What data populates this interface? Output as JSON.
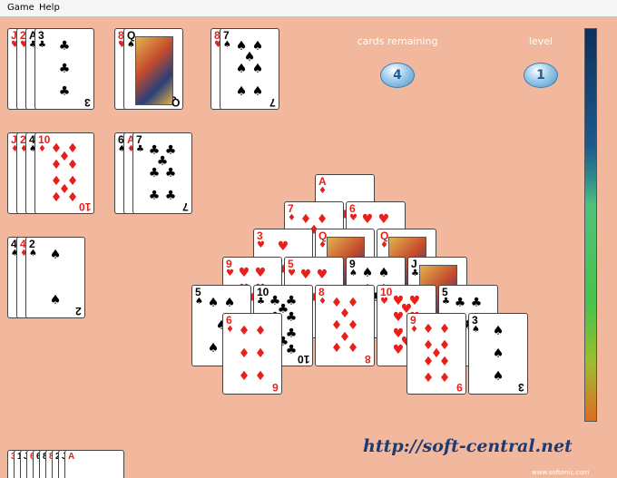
{
  "menu": [
    "Game",
    "Help"
  ],
  "stats": {
    "cards_label": "cards remaining",
    "cards_value": "4",
    "level_label": "level",
    "level_value": "1"
  },
  "footer": {
    "url": "http://soft-central.net",
    "copyright": "www.softonic.com"
  },
  "colors": {
    "background": "#f2b89d",
    "red": "#e8201a",
    "black": "#000000",
    "text_on_felt": "#ffffff",
    "url": "#1c3a73"
  },
  "stacks": [
    {
      "name": "stack-1",
      "under": [
        {
          "r": "J",
          "s": "♥"
        },
        {
          "r": "2",
          "s": "♥"
        },
        {
          "r": "A",
          "s": "♣"
        }
      ],
      "top": {
        "r": "3",
        "s": "♣"
      }
    },
    {
      "name": "stack-2",
      "under": [
        {
          "r": "8",
          "s": "♥"
        }
      ],
      "top": {
        "r": "Q",
        "s": "♠"
      }
    },
    {
      "name": "stack-3",
      "under": [
        {
          "r": "8",
          "s": "♥"
        }
      ],
      "top": {
        "r": "7",
        "s": "♠"
      }
    },
    {
      "name": "stack-4",
      "under": [
        {
          "r": "J",
          "s": "♦"
        },
        {
          "r": "2",
          "s": "♦"
        },
        {
          "r": "4",
          "s": "♠"
        }
      ],
      "top": {
        "r": "10",
        "s": "♦"
      }
    },
    {
      "name": "stack-5",
      "under": [
        {
          "r": "6",
          "s": "♠"
        },
        {
          "r": "A",
          "s": "♦"
        }
      ],
      "top": {
        "r": "7",
        "s": "♣"
      }
    },
    {
      "name": "stack-6",
      "under": [
        {
          "r": "4",
          "s": "♠"
        },
        {
          "r": "4",
          "s": "♦"
        }
      ],
      "top": {
        "r": "2",
        "s": "♠"
      }
    }
  ],
  "pyramid": [
    [
      {
        "r": "A",
        "s": "♦"
      }
    ],
    [
      {
        "r": "7",
        "s": "♦"
      },
      {
        "r": "6",
        "s": "♥"
      }
    ],
    [
      {
        "r": "3",
        "s": "♥"
      },
      {
        "r": "Q",
        "s": "♦"
      },
      {
        "r": "Q",
        "s": "♦"
      }
    ],
    [
      {
        "r": "9",
        "s": "♥"
      },
      {
        "r": "5",
        "s": "♥"
      },
      {
        "r": "9",
        "s": "♠"
      },
      {
        "r": "J",
        "s": "♣"
      }
    ],
    [
      {
        "r": "5",
        "s": "♠"
      },
      {
        "r": "10",
        "s": "♣"
      },
      {
        "r": "8",
        "s": "♦"
      },
      {
        "r": "10",
        "s": "♥"
      },
      {
        "r": "5",
        "s": "♣"
      }
    ],
    [
      {
        "r": "6",
        "s": "♦"
      },
      {
        "r": "9",
        "s": "♦"
      },
      {
        "r": "3",
        "s": "♠"
      }
    ]
  ],
  "deck": [
    "3",
    "10",
    "J",
    "6",
    "6",
    "8",
    "8",
    "2",
    "J",
    "A"
  ]
}
